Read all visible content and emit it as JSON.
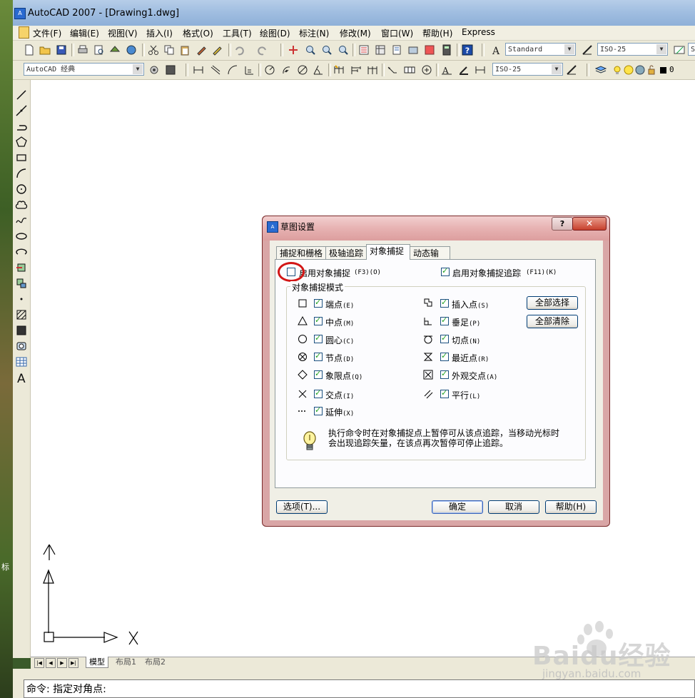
{
  "window": {
    "title": "AutoCAD 2007 - [Drawing1.dwg]",
    "icon": "autocad-app-icon"
  },
  "menu": [
    "文件(F)",
    "编辑(E)",
    "视图(V)",
    "插入(I)",
    "格式(O)",
    "工具(T)",
    "绘图(D)",
    "标注(N)",
    "修改(M)",
    "窗口(W)",
    "帮助(H)",
    "Express"
  ],
  "toolbar1": {
    "text_style": "Standard",
    "dim_style": "ISO-25",
    "extra": "S"
  },
  "toolbar2": {
    "workspace": "AutoCAD 经典",
    "dim_style2": "ISO-25",
    "layer_value": "0"
  },
  "layout_tabs": [
    "模型",
    "布局1",
    "布局2"
  ],
  "command_line": "命令: 指定对角点:",
  "ucs": {
    "x_label": "X",
    "y_label": "Y"
  },
  "dialog": {
    "title": "草图设置",
    "help_glyph": "?",
    "close_glyph": "✕",
    "tabs": [
      "捕捉和栅格",
      "极轴追踪",
      "对象捕捉",
      "动态输入"
    ],
    "active_tab": "对象捕捉",
    "enable_osnap": {
      "label": "启用对象捕捉",
      "key": "(F3)(O)",
      "checked": false
    },
    "enable_tracking": {
      "label": "启用对象捕捉追踪",
      "key": "(F11)(K)",
      "checked": true
    },
    "group_title": "对象捕捉模式",
    "modes_left": [
      {
        "label": "端点",
        "key": "(E)",
        "checked": true
      },
      {
        "label": "中点",
        "key": "(M)",
        "checked": true
      },
      {
        "label": "圆心",
        "key": "(C)",
        "checked": true
      },
      {
        "label": "节点",
        "key": "(D)",
        "checked": true
      },
      {
        "label": "象限点",
        "key": "(Q)",
        "checked": true
      },
      {
        "label": "交点",
        "key": "(I)",
        "checked": true
      },
      {
        "label": "延伸",
        "key": "(X)",
        "checked": true
      }
    ],
    "modes_right": [
      {
        "label": "插入点",
        "key": "(S)",
        "checked": true
      },
      {
        "label": "垂足",
        "key": "(P)",
        "checked": true
      },
      {
        "label": "切点",
        "key": "(N)",
        "checked": true
      },
      {
        "label": "最近点",
        "key": "(R)",
        "checked": true
      },
      {
        "label": "外观交点",
        "key": "(A)",
        "checked": true
      },
      {
        "label": "平行",
        "key": "(L)",
        "checked": true
      }
    ],
    "select_all": "全部选择",
    "clear_all": "全部清除",
    "info_line1": "执行命令时在对象捕捉点上暂停可从该点追踪，当移动光标时",
    "info_line2": "会出现追踪矢量，在该点再次暂停可停止追踪。",
    "options_button": "选项(T)...",
    "ok_button": "确定",
    "cancel_button": "取消",
    "help_button": "帮助(H)"
  },
  "watermark": {
    "main": "Baidu经验",
    "sub": "jingyan.baidu.com"
  },
  "side_char": "标",
  "colors": {
    "highlight_circle": "#d21616",
    "dialog_frame": "#d9a6a6",
    "check": "#21a121"
  }
}
